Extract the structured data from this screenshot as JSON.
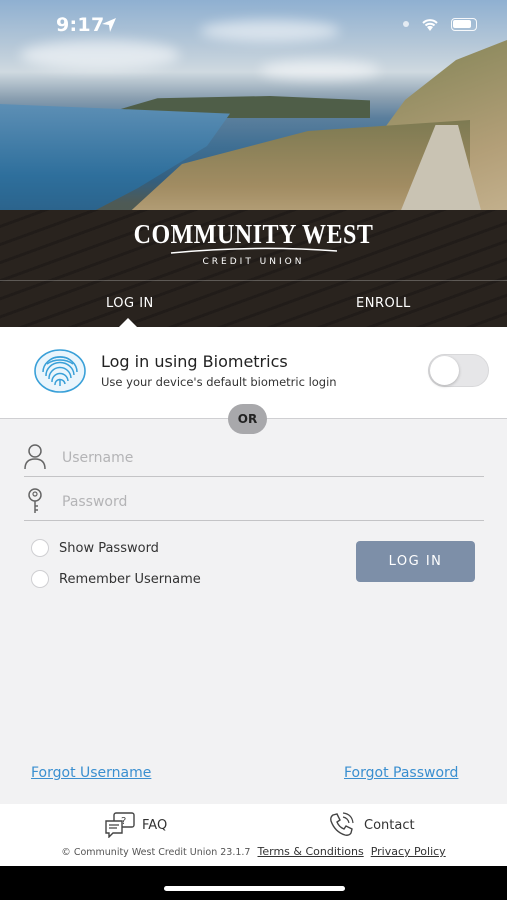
{
  "status_bar": {
    "time": "9:17",
    "icons": [
      "location-arrow-icon",
      "signal-icon",
      "wifi-icon",
      "battery-icon"
    ]
  },
  "brand": {
    "name": "COMMUNITY WEST",
    "subtitle": "CREDIT UNION"
  },
  "tabs": [
    {
      "label": "LOG IN",
      "active": true
    },
    {
      "label": "ENROLL",
      "active": false
    }
  ],
  "biometrics": {
    "title": "Log in using Biometrics",
    "subtitle": "Use your device's default biometric login",
    "enabled": false,
    "icon": "fingerprint-icon"
  },
  "divider_label": "OR",
  "form": {
    "username_placeholder": "Username",
    "password_placeholder": "Password",
    "username_value": "",
    "password_value": "",
    "show_password_label": "Show Password",
    "remember_username_label": "Remember Username",
    "login_button": "LOG IN"
  },
  "links": {
    "forgot_username": "Forgot Username",
    "forgot_password": "Forgot Password"
  },
  "footer": {
    "faq_label": "FAQ",
    "contact_label": "Contact",
    "copyright": "© Community West Credit Union 23.1.7",
    "terms": "Terms & Conditions",
    "privacy": "Privacy Policy"
  },
  "colors": {
    "accent_button": "#7d8fa8",
    "link": "#3a8fd0",
    "fingerprint": "#3aa0d8",
    "form_bg": "#f2f2f3"
  }
}
